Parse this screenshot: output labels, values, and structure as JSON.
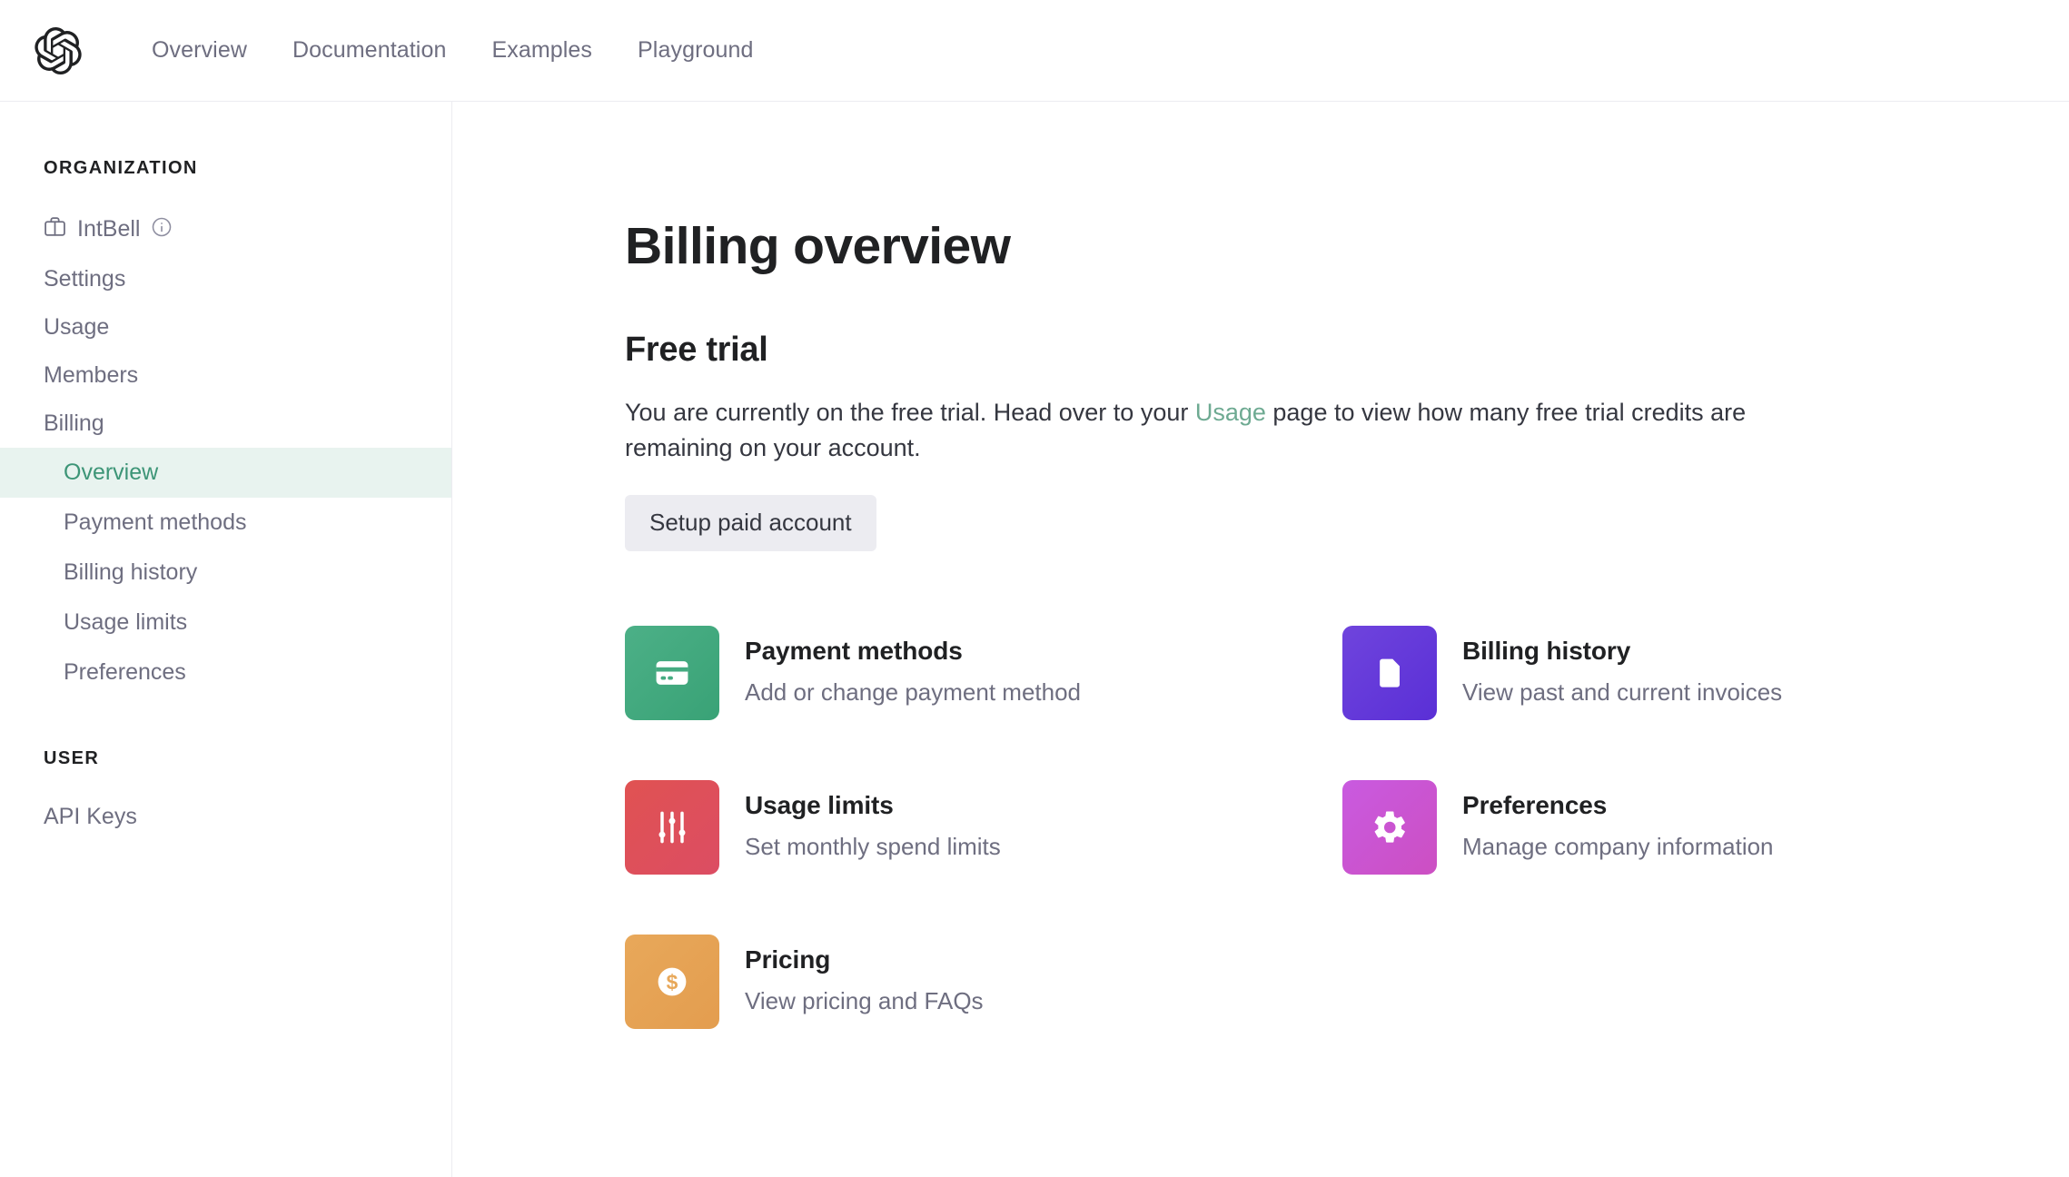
{
  "topnav": {
    "logo_icon": "openai-logo-icon",
    "links": [
      {
        "label": "Overview"
      },
      {
        "label": "Documentation"
      },
      {
        "label": "Examples"
      },
      {
        "label": "Playground"
      }
    ]
  },
  "sidebar": {
    "organization": {
      "section_label": "ORGANIZATION",
      "org_name": "IntBell",
      "org_icon": "briefcase-icon",
      "info_icon": "info-circle-icon",
      "items": [
        {
          "label": "Settings"
        },
        {
          "label": "Usage"
        },
        {
          "label": "Members"
        },
        {
          "label": "Billing"
        }
      ],
      "billing_subitems": [
        {
          "label": "Overview",
          "active": true
        },
        {
          "label": "Payment methods",
          "active": false
        },
        {
          "label": "Billing history",
          "active": false
        },
        {
          "label": "Usage limits",
          "active": false
        },
        {
          "label": "Preferences",
          "active": false
        }
      ]
    },
    "user": {
      "section_label": "USER",
      "items": [
        {
          "label": "API Keys"
        }
      ]
    },
    "active_color": "#3d9577",
    "active_bg": "#e8f3ef"
  },
  "main": {
    "page_title": "Billing overview",
    "free_trial": {
      "heading": "Free trial",
      "body_part1": "You are currently on the free trial. Head over to your ",
      "link_text": "Usage",
      "body_part2": " page to view how many free trial credits are remaining on your account.",
      "button_label": "Setup paid account"
    },
    "cards": [
      {
        "title": "Payment methods",
        "description": "Add or change payment method",
        "icon": "credit-card-icon",
        "color_start": "#4cb087",
        "color_end": "#39a276"
      },
      {
        "title": "Billing history",
        "description": "View past and current invoices",
        "icon": "document-icon",
        "color_start": "#6f44dd",
        "color_end": "#5a2fd6"
      },
      {
        "title": "Usage limits",
        "description": "Set monthly spend limits",
        "icon": "sliders-icon",
        "color_start": "#e05252",
        "color_end": "#dc4d63"
      },
      {
        "title": "Preferences",
        "description": "Manage company information",
        "icon": "gear-icon",
        "color_start": "#c95ae0",
        "color_end": "#cc4fc2"
      },
      {
        "title": "Pricing",
        "description": "View pricing and FAQs",
        "icon": "dollar-circle-icon",
        "color_start": "#e8a85a",
        "color_end": "#e39d4f"
      }
    ]
  }
}
